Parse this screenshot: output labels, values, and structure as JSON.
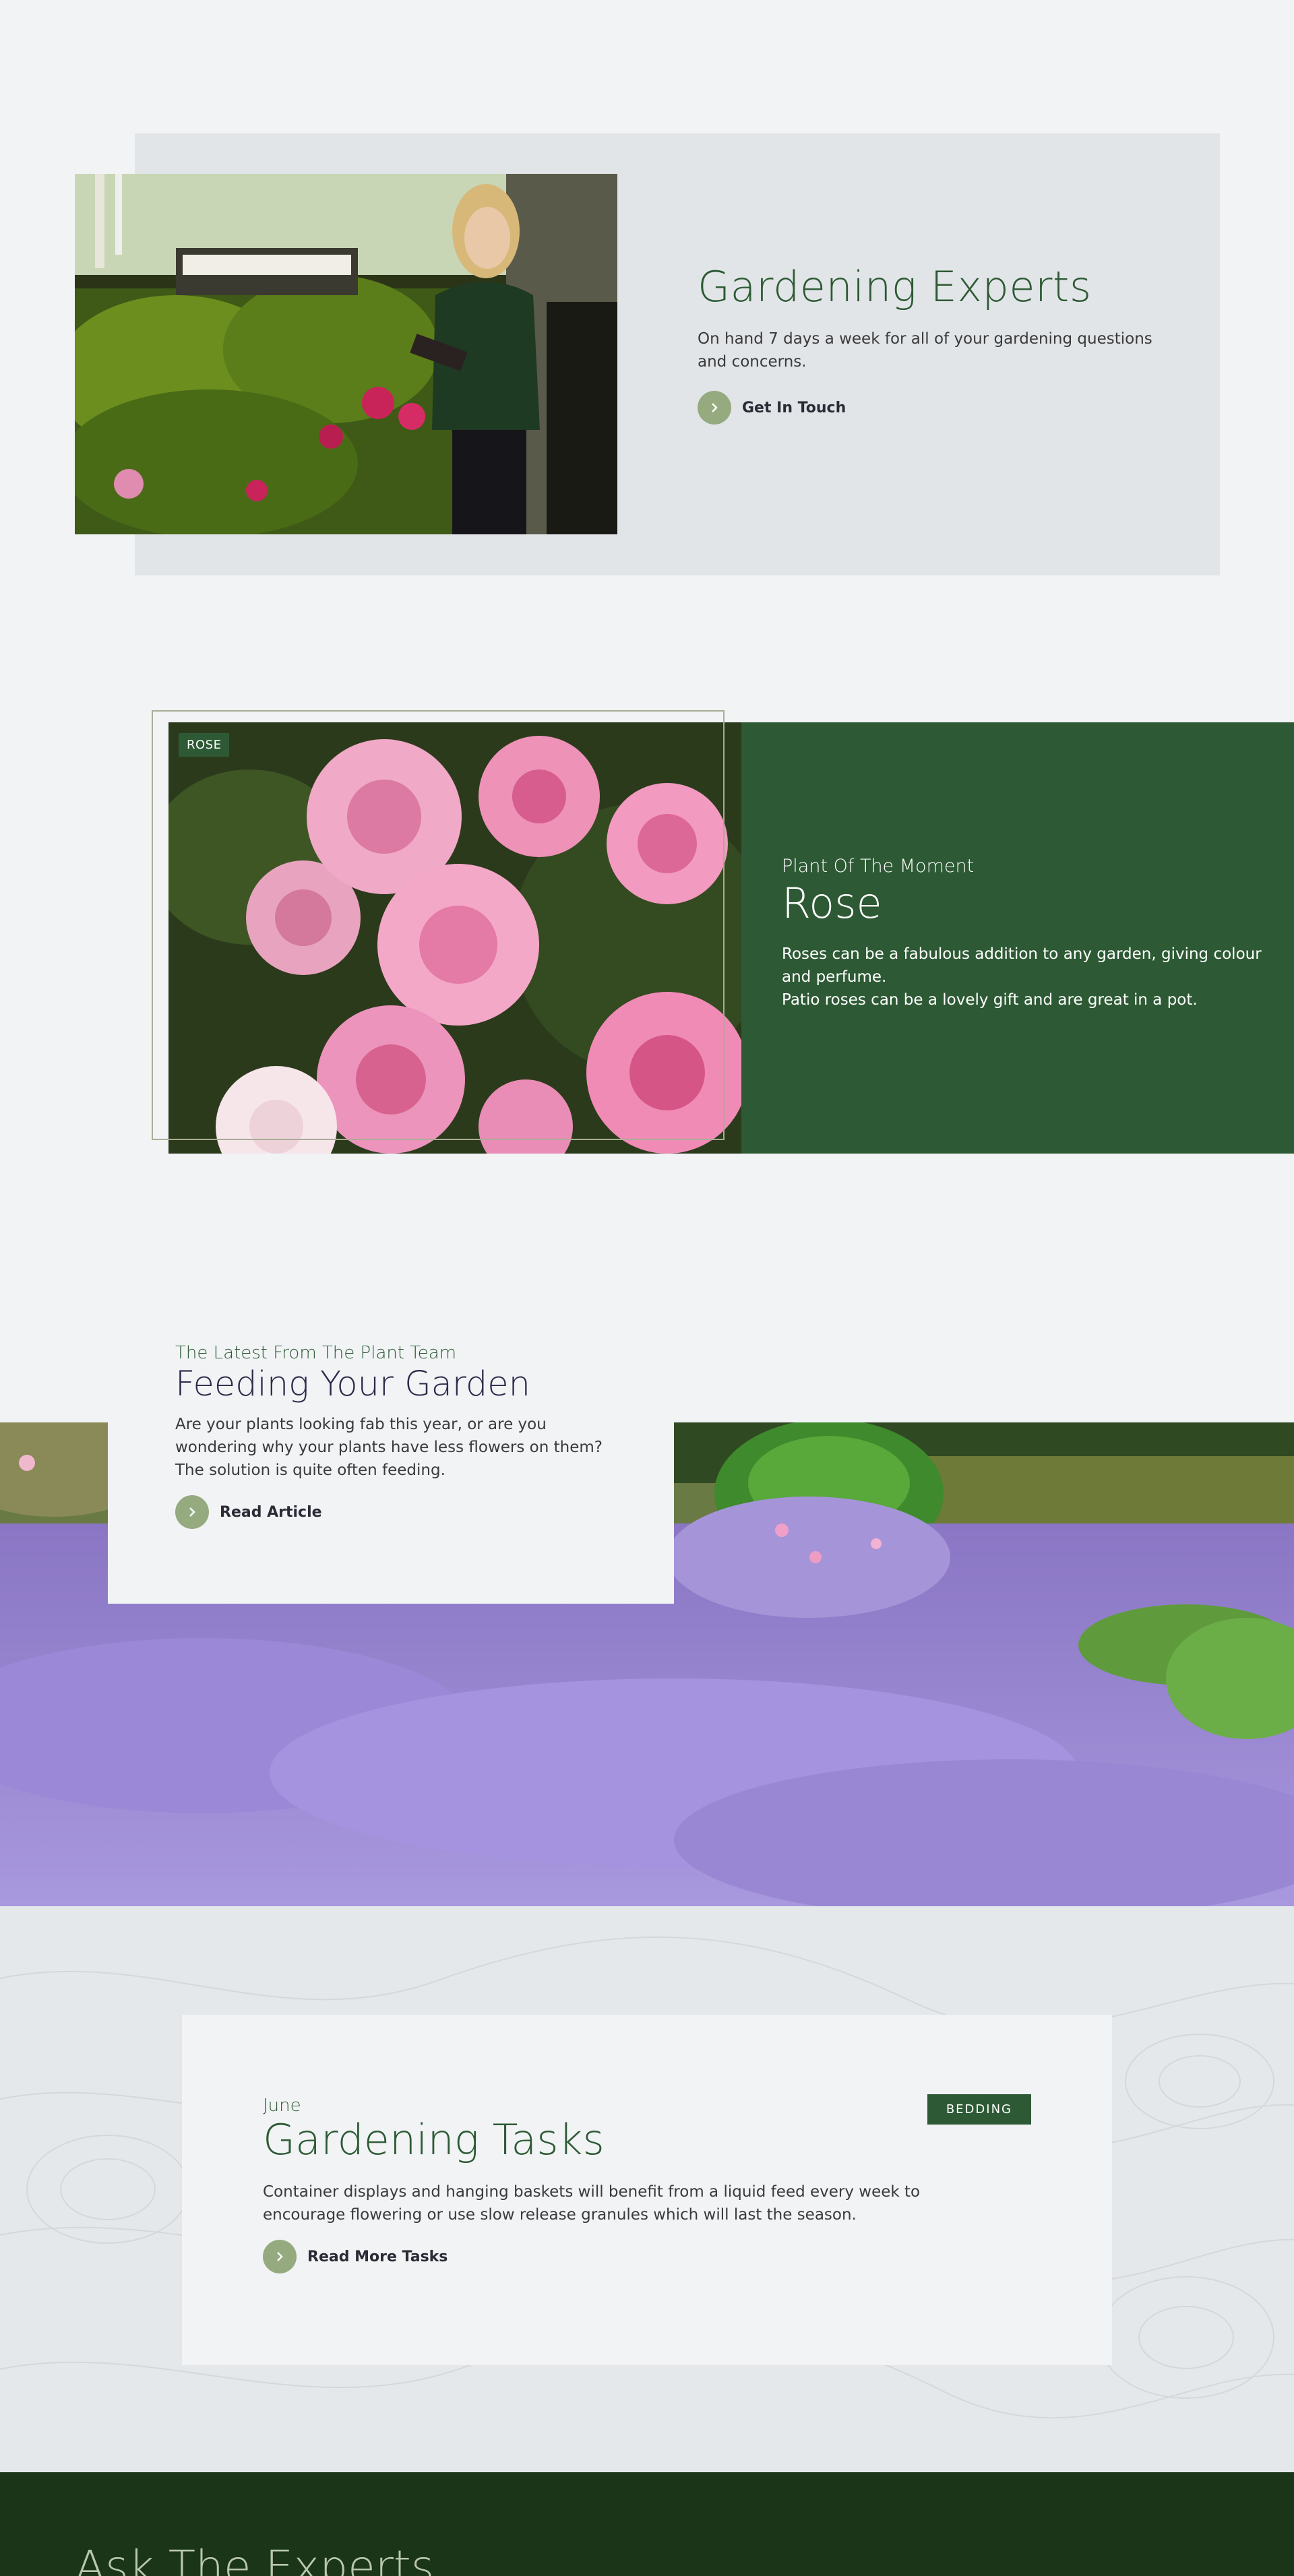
{
  "experts": {
    "title": "Gardening Experts",
    "description": "On hand 7 days a week for all of your gardening questions and concerns.",
    "cta_label": "Get In Touch"
  },
  "plant_of_moment": {
    "tag": "ROSE",
    "eyebrow": "Plant Of The Moment",
    "title": "Rose",
    "description_line1": "Roses can be a fabulous addition to any garden, giving colour and perfume.",
    "description_line2": "Patio roses can be a lovely gift and are great in a pot."
  },
  "feeding": {
    "eyebrow": "The Latest From The Plant Team",
    "title": "Feeding Your Garden",
    "description_line1": "Are your plants looking fab this year, or are you wondering why your plants have less flowers on them?",
    "description_line2": "The solution is quite often feeding.",
    "cta_label": "Read Article"
  },
  "tasks": {
    "month": "June",
    "title": "Gardening Tasks",
    "badge": "BEDDING",
    "description": "Container displays and hanging baskets will benefit from a liquid feed every week to encourage flowering or use slow release granules which will last the season.",
    "cta_label": "Read More Tasks"
  },
  "ask": {
    "title": "Ask The Experts"
  },
  "colors": {
    "brand_green": "#2d5a34",
    "accent_sage": "#96aa80",
    "dark_footer": "#1b3519",
    "page_bg": "#f1f3f5"
  }
}
